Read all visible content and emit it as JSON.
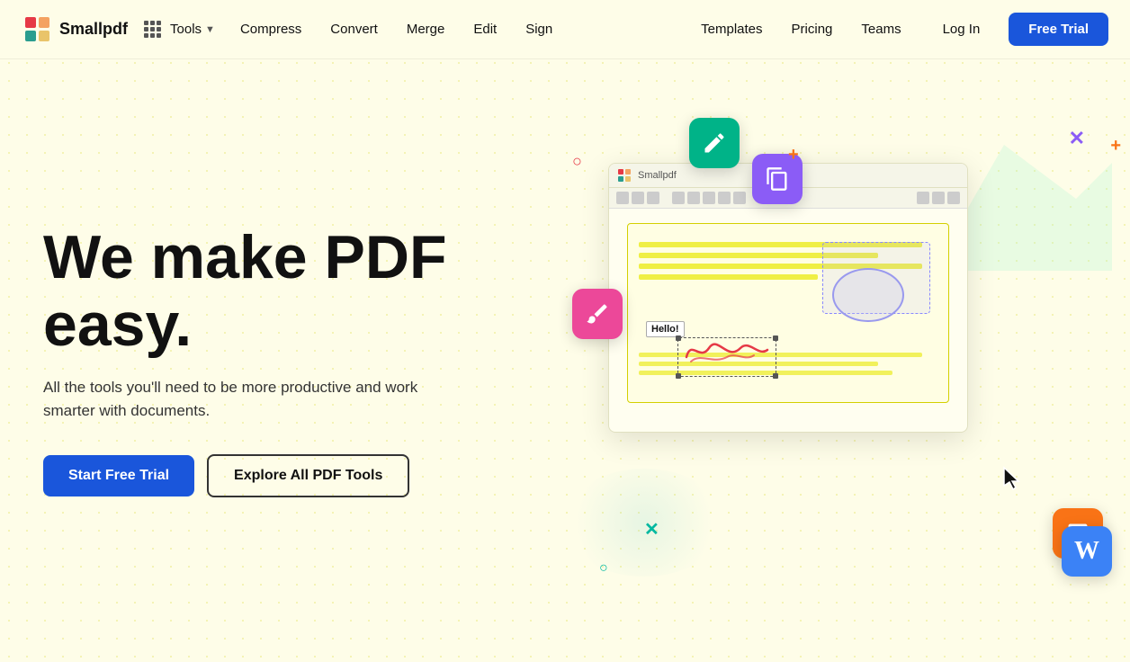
{
  "brand": {
    "name": "Smallpdf",
    "logo_alt": "Smallpdf logo"
  },
  "nav": {
    "grid_icon_label": "apps grid",
    "tools_label": "Tools",
    "compress_label": "Compress",
    "convert_label": "Convert",
    "merge_label": "Merge",
    "edit_label": "Edit",
    "sign_label": "Sign",
    "templates_label": "Templates",
    "pricing_label": "Pricing",
    "teams_label": "Teams",
    "login_label": "Log In",
    "free_trial_label": "Free Trial"
  },
  "hero": {
    "headline_line1": "We make PDF",
    "headline_line2": "easy.",
    "subtitle": "All the tools you'll need to be more productive and work smarter with documents.",
    "cta_primary": "Start Free Trial",
    "cta_secondary": "Explore All PDF Tools"
  },
  "illustration": {
    "editor_title": "Smallpdf",
    "hello_label": "Hello!",
    "floating_icons": [
      {
        "id": "edit-icon",
        "symbol": "✎",
        "color": "#00b388"
      },
      {
        "id": "copy-icon",
        "symbol": "⧉",
        "color": "#8b5cf6"
      },
      {
        "id": "pen-icon",
        "symbol": "✒",
        "color": "#ec4899"
      },
      {
        "id": "image-icon",
        "symbol": "🖼",
        "color": "#f97316"
      },
      {
        "id": "word-icon",
        "symbol": "W",
        "color": "#2563eb"
      }
    ]
  },
  "colors": {
    "primary_blue": "#1a56db",
    "background": "#fefde8",
    "heading": "#111111",
    "body_text": "#333333"
  }
}
